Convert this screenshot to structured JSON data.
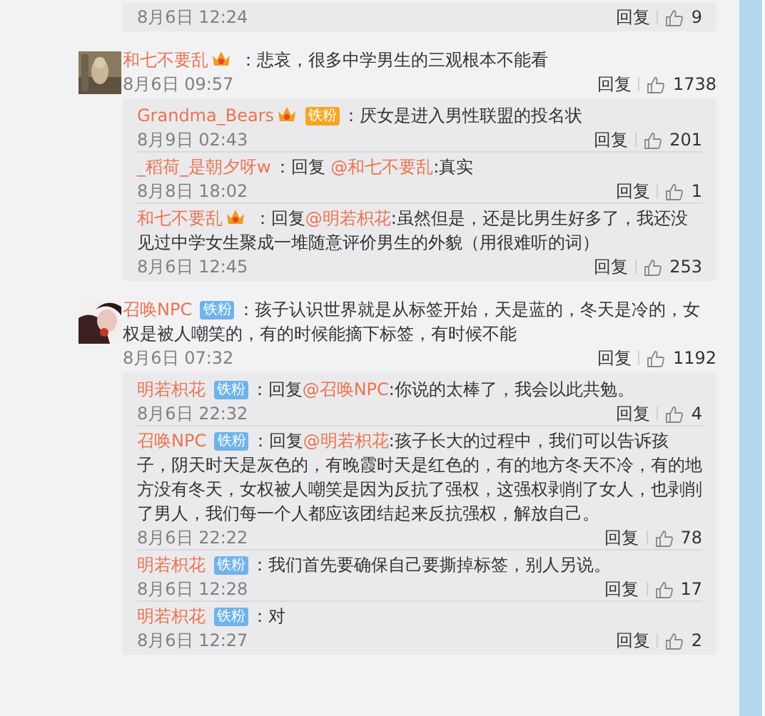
{
  "top_fragment": {
    "time": "8月6日 12:24",
    "reply": "回复",
    "likes": "9"
  },
  "comments": [
    {
      "user": "和七不要乱",
      "badge": {
        "kind": "crown"
      },
      "text": "：悲哀，很多中学男生的三观根本不能看",
      "time": "8月6日 09:57",
      "reply": "回复",
      "likes": "1738",
      "replies": [
        {
          "user": "Grandma_Bears",
          "badge": {
            "kind": "crown_fan",
            "label": "铁粉"
          },
          "text": "：厌女是进入男性联盟的投名状",
          "time": "8月9日 02:43",
          "reply": "回复",
          "likes": "201"
        },
        {
          "user": "_稻荷_是朝夕呀w",
          "prefix": "：回复 ",
          "mention": "@和七不要乱",
          "text": ":真实",
          "time": "8月8日 18:02",
          "reply": "回复",
          "likes": "1"
        },
        {
          "user": "和七不要乱",
          "badge": {
            "kind": "crown"
          },
          "prefix": "：回复",
          "mention": "@明若枳花",
          "text": ":虽然但是，还是比男生好多了，我还没见过中学女生聚成一堆随意评价男生的外貌（用很难听的词）",
          "time": "8月6日 12:45",
          "reply": "回复",
          "likes": "253"
        }
      ]
    },
    {
      "user": "召唤NPC",
      "badge": {
        "kind": "fan",
        "label": "铁粉"
      },
      "text": "：孩子认识世界就是从标签开始，天是蓝的，冬天是冷的，女权是被人嘲笑的，有的时候能摘下标签，有时候不能",
      "time": "8月6日 07:32",
      "reply": "回复",
      "likes": "1192",
      "replies": [
        {
          "user": "明若枳花",
          "badge": {
            "kind": "fan",
            "label": "铁粉"
          },
          "prefix": "：回复",
          "mention": "@召唤NPC",
          "text": ":你说的太棒了，我会以此共勉。",
          "time": "8月6日 22:32",
          "reply": "回复",
          "likes": "4"
        },
        {
          "user": "召唤NPC",
          "badge": {
            "kind": "fan",
            "label": "铁粉"
          },
          "prefix": "：回复",
          "mention": "@明若枳花",
          "text": ":孩子长大的过程中，我们可以告诉孩子，阴天时天是灰色的，有晚霞时天是红色的，有的地方冬天不冷，有的地方没有冬天，女权被人嘲笑是因为反抗了强权，这强权剥削了女人，也剥削了男人，我们每一个人都应该团结起来反抗强权，解放自己。",
          "time": "8月6日 22:22",
          "reply": "回复",
          "likes": "78"
        },
        {
          "user": "明若枳花",
          "badge": {
            "kind": "fan",
            "label": "铁粉"
          },
          "text": "：我们首先要确保自己要撕掉标签，别人另说。",
          "time": "8月6日 12:28",
          "reply": "回复",
          "likes": "17"
        },
        {
          "user": "明若枳花",
          "badge": {
            "kind": "fan",
            "label": "铁粉"
          },
          "text": "：对",
          "time": "8月6日 12:27",
          "reply": "回复",
          "likes": "2"
        }
      ]
    }
  ]
}
